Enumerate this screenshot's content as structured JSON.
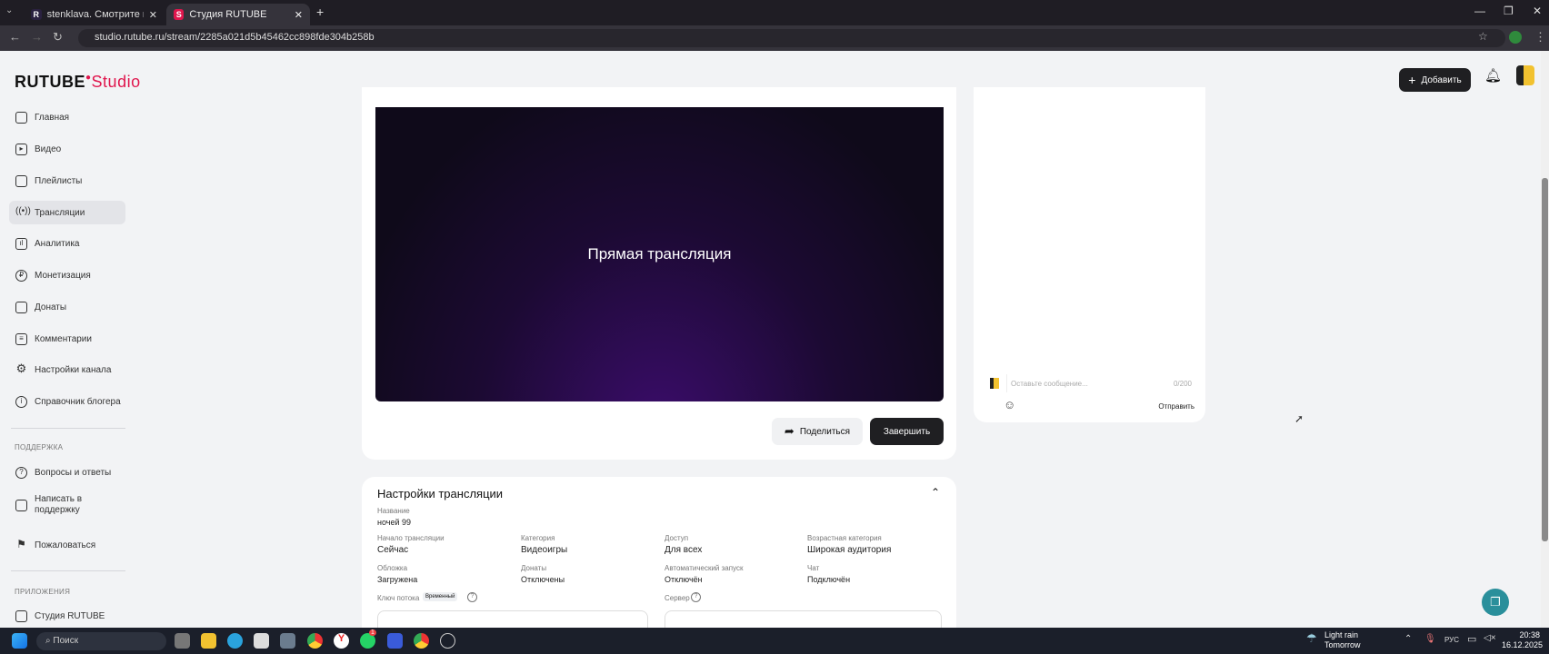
{
  "browser": {
    "tabs": [
      {
        "title": "stenklava. Смотрите видео он",
        "favicon": "R",
        "active": false
      },
      {
        "title": "Студия RUTUBE",
        "favicon": "S",
        "active": true
      }
    ],
    "url": "studio.rutube.ru/stream/2285a021d5b45462cc898fde304b258b"
  },
  "header": {
    "logo_main": "RUTUBE",
    "logo_sub": "Studio",
    "add_label": "Добавить"
  },
  "sidebar": {
    "items": [
      {
        "label": "Главная",
        "icon": "home-icon"
      },
      {
        "label": "Видео",
        "icon": "video-icon"
      },
      {
        "label": "Плейлисты",
        "icon": "playlist-icon"
      },
      {
        "label": "Трансляции",
        "icon": "broadcast-icon"
      },
      {
        "label": "Аналитика",
        "icon": "analytics-icon"
      },
      {
        "label": "Монетизация",
        "icon": "ruble-icon"
      },
      {
        "label": "Донаты",
        "icon": "wallet-icon"
      },
      {
        "label": "Комментарии",
        "icon": "comment-icon"
      },
      {
        "label": "Настройки канала",
        "icon": "gear-icon"
      },
      {
        "label": "Справочник блогера",
        "icon": "info-icon"
      }
    ],
    "support_title": "ПОДДЕРЖКА",
    "support": [
      {
        "label": "Вопросы и ответы"
      },
      {
        "label": "Написать в поддержку"
      },
      {
        "label": "Пожаловаться"
      }
    ],
    "apps_title": "ПРИЛОЖЕНИЯ",
    "apps": [
      {
        "label": "Студия RUTUBE"
      }
    ]
  },
  "player": {
    "overlay": "Прямая трансляция",
    "share_label": "Поделиться",
    "finish_label": "Завершить"
  },
  "chat": {
    "placeholder": "Оставьте сообщение...",
    "counter": "0/200",
    "send_label": "Отправить"
  },
  "settings": {
    "title": "Настройки трансляции",
    "name_label": "Название",
    "name_value": "ночей 99",
    "fields": [
      {
        "label": "Начало трансляции",
        "value": "Сейчас"
      },
      {
        "label": "Категория",
        "value": "Видеоигры"
      },
      {
        "label": "Доступ",
        "value": "Для всех"
      },
      {
        "label": "Возрастная категория",
        "value": "Широкая аудитория"
      },
      {
        "label": "Обложка",
        "value": "Загружена"
      },
      {
        "label": "Донаты",
        "value": "Отключены"
      },
      {
        "label": "Автоматический запуск",
        "value": "Отключён"
      },
      {
        "label": "Чат",
        "value": "Подключён"
      }
    ],
    "key_label": "Ключ потока",
    "key_badge": "Временный",
    "server_label": "Сервер"
  },
  "taskbar": {
    "search": "Поиск",
    "weather": "Light rain",
    "weather_sub": "Tomorrow",
    "lang": "РУС",
    "time": "20:38",
    "date": "16.12.2025",
    "whatsapp_badge": "1"
  },
  "colors": {
    "accent": "#e0164d",
    "dark": "#1f1f22"
  }
}
